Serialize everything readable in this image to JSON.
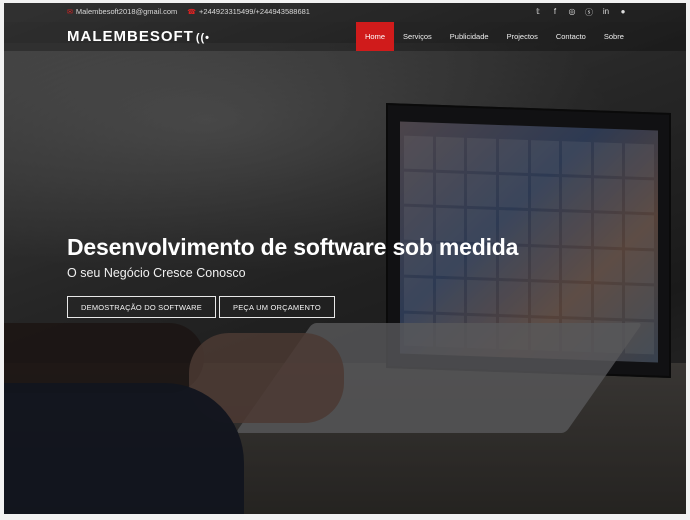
{
  "topbar": {
    "email": "Malembesoft2018@gmail.com",
    "phone": "+244923315499/+244943588681",
    "email_icon": "envelope-icon",
    "phone_icon": "phone-icon",
    "social": [
      {
        "name": "twitter-icon",
        "glyph": "𝕥"
      },
      {
        "name": "facebook-icon",
        "glyph": "f"
      },
      {
        "name": "instagram-icon",
        "glyph": "◎"
      },
      {
        "name": "skype-icon",
        "glyph": "ⓢ"
      },
      {
        "name": "linkedin-icon",
        "glyph": "in"
      },
      {
        "name": "chat-icon",
        "glyph": "●"
      }
    ]
  },
  "nav": {
    "logo": "MALEMBESOFT",
    "logo_icon": "wifi-icon",
    "items": [
      {
        "label": "Home",
        "active": true
      },
      {
        "label": "Serviços",
        "active": false
      },
      {
        "label": "Publicidade",
        "active": false
      },
      {
        "label": "Projectos",
        "active": false
      },
      {
        "label": "Contacto",
        "active": false
      },
      {
        "label": "Sobre",
        "active": false
      }
    ],
    "accent_color": "#d01b1b"
  },
  "hero": {
    "title": "Desenvolvimento de software sob medida",
    "subtitle": "O seu Negócio Cresce Conosco",
    "buttons": [
      {
        "label": "DEMOSTRAÇÃO DO SOFTWARE"
      },
      {
        "label": "PEÇA UM ORÇAMENTO"
      }
    ]
  }
}
